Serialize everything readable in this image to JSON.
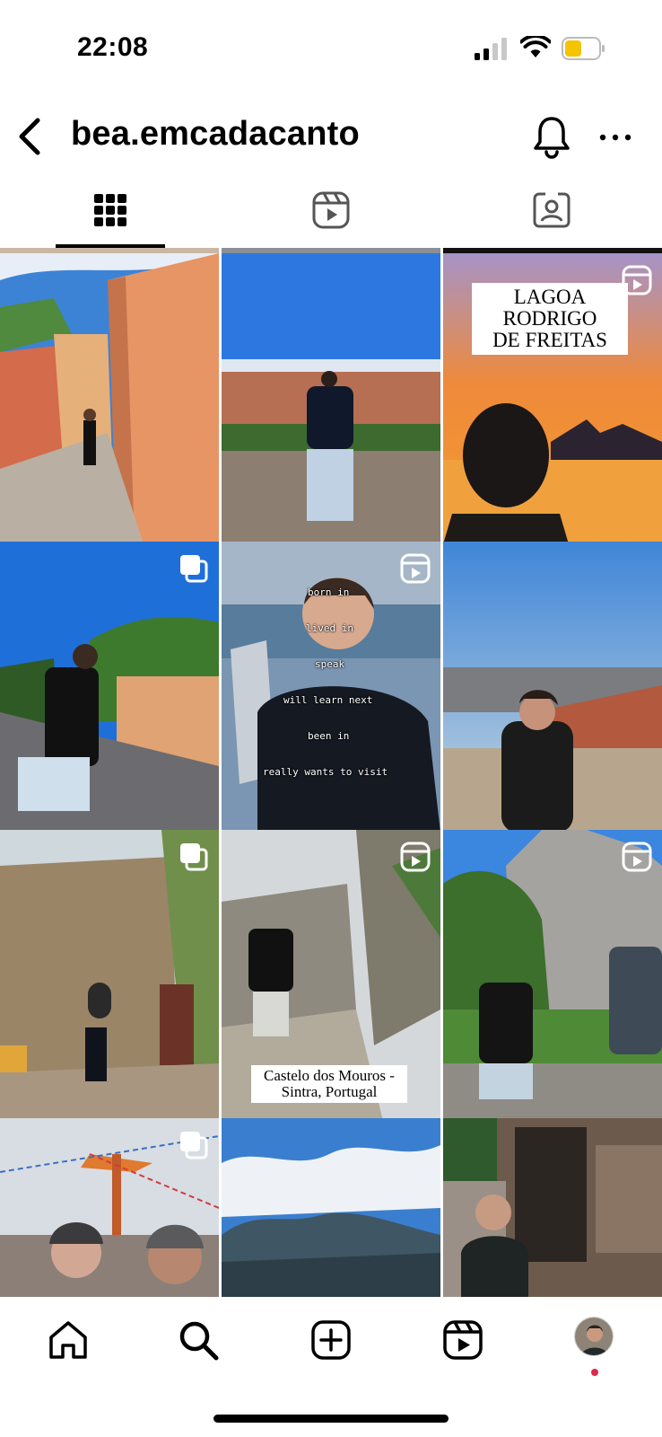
{
  "status_bar": {
    "time": "22:08",
    "battery_color": "#f5c400"
  },
  "header": {
    "username": "bea.emcadacanto"
  },
  "tabs": [
    {
      "name": "posts-grid",
      "icon": "grid-icon",
      "selected": true
    },
    {
      "name": "reels",
      "icon": "reels-icon",
      "selected": false
    },
    {
      "name": "tagged",
      "icon": "tagged-icon",
      "selected": false
    }
  ],
  "posts": {
    "p3": {
      "caption_lines": [
        "LAGOA",
        "RODRIGO",
        "DE FREITAS"
      ],
      "badge": "reels-icon"
    },
    "p4": {
      "badge": "carousel-icon"
    },
    "p5": {
      "badge": "reels-icon",
      "overlay": [
        "born in",
        "lived in",
        "speak",
        "will learn next",
        "been in",
        "really wants to visit"
      ]
    },
    "p7": {
      "badge": "carousel-icon"
    },
    "p8": {
      "caption_lines": [
        "Castelo dos Mouros -",
        "Sintra, Portugal"
      ],
      "badge": "reels-icon"
    },
    "p9": {
      "badge": "reels-icon"
    },
    "p10": {
      "badge": "carousel-icon"
    }
  },
  "bottom_nav": [
    {
      "name": "home",
      "icon": "home-icon"
    },
    {
      "name": "search",
      "icon": "search-icon"
    },
    {
      "name": "create",
      "icon": "plus-square-icon"
    },
    {
      "name": "reels",
      "icon": "reels-icon"
    },
    {
      "name": "profile",
      "icon": "avatar"
    }
  ],
  "colors": {
    "accent_dot": "#e2264d"
  }
}
